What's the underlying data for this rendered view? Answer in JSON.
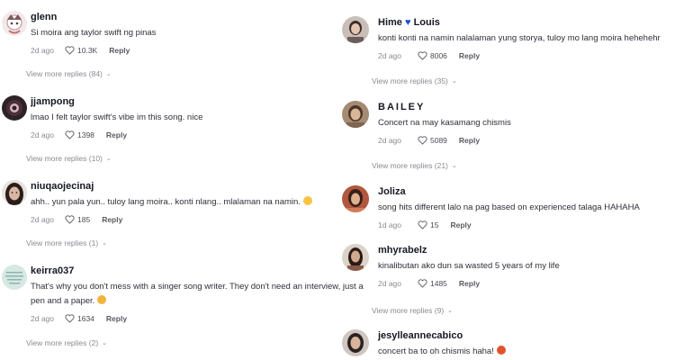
{
  "left": {
    "comments": [
      {
        "username": "glenn",
        "text": "Si moira ang taylor swift ng pinas",
        "date": "2d ago",
        "likes": "10.3K",
        "reply": "Reply",
        "view_more": "View more replies (84)",
        "avatar_icon": "anime-avatar-icon",
        "avatar_color": "#c9a9a6"
      },
      {
        "username": "jjampong",
        "text": "lmao I felt taylor swift's vibe im this song. nice",
        "date": "2d ago",
        "likes": "1398",
        "reply": "Reply",
        "view_more": "View more replies (10)",
        "avatar_icon": "dark-avatar-icon",
        "avatar_color": "#3b2a30"
      },
      {
        "username": "niuqaojecinaj",
        "text": "ahh.. yun pala yun.. tuloy lang moira.. konti nlang.. mlalaman na namin.",
        "emoji": "smile-emoji-icon",
        "date": "2d ago",
        "likes": "185",
        "reply": "Reply",
        "view_more": "View more replies (1)",
        "avatar_icon": "photo-avatar-icon",
        "avatar_color": "#6b4f46"
      },
      {
        "username": "keirra037",
        "text_line1": "That's why you don't mess with a singer song writer. They don't need an interview, just a",
        "text_line2": "pen and a paper.",
        "emoji": "wink-emoji-icon",
        "date": "2d ago",
        "likes": "1634",
        "reply": "Reply",
        "view_more": "View more replies (2)",
        "avatar_icon": "text-avatar-icon",
        "avatar_color": "#cfe3e0"
      }
    ]
  },
  "right": {
    "comments": [
      {
        "username": "Hime",
        "username_suffix": "Louis",
        "text": "konti konti na namin nalalaman yung storya, tuloy mo lang moira hehehehr",
        "date": "2d ago",
        "likes": "8006",
        "reply": "Reply",
        "view_more": "View more replies (35)",
        "avatar_icon": "photo-avatar-icon",
        "avatar_color": "#7a6a64"
      },
      {
        "username": "BAILEY",
        "text": "Concert na may kasamang chismis",
        "date": "2d ago",
        "likes": "5089",
        "reply": "Reply",
        "view_more": "View more replies (21)",
        "avatar_icon": "photo-avatar-icon",
        "avatar_color": "#8e7663"
      },
      {
        "username": "Joliza",
        "text": "song hits different lalo na pag based on experienced talaga HAHAHA",
        "date": "1d ago",
        "likes": "15",
        "reply": "Reply",
        "avatar_icon": "photo-avatar-icon",
        "avatar_color": "#9a4a3c"
      },
      {
        "username": "mhyrabelz",
        "text": "kinalibutan ako dun sa wasted 5 years of my life",
        "date": "2d ago",
        "likes": "1485",
        "reply": "Reply",
        "view_more": "View more replies (9)",
        "avatar_icon": "photo-avatar-icon",
        "avatar_color": "#5a3c38"
      },
      {
        "username": "jesylleannecabico",
        "text": "concert ba to oh chismis haha!",
        "emoji": "angry-emoji-icon",
        "avatar_icon": "photo-avatar-icon",
        "avatar_color": "#3e3433"
      }
    ]
  }
}
